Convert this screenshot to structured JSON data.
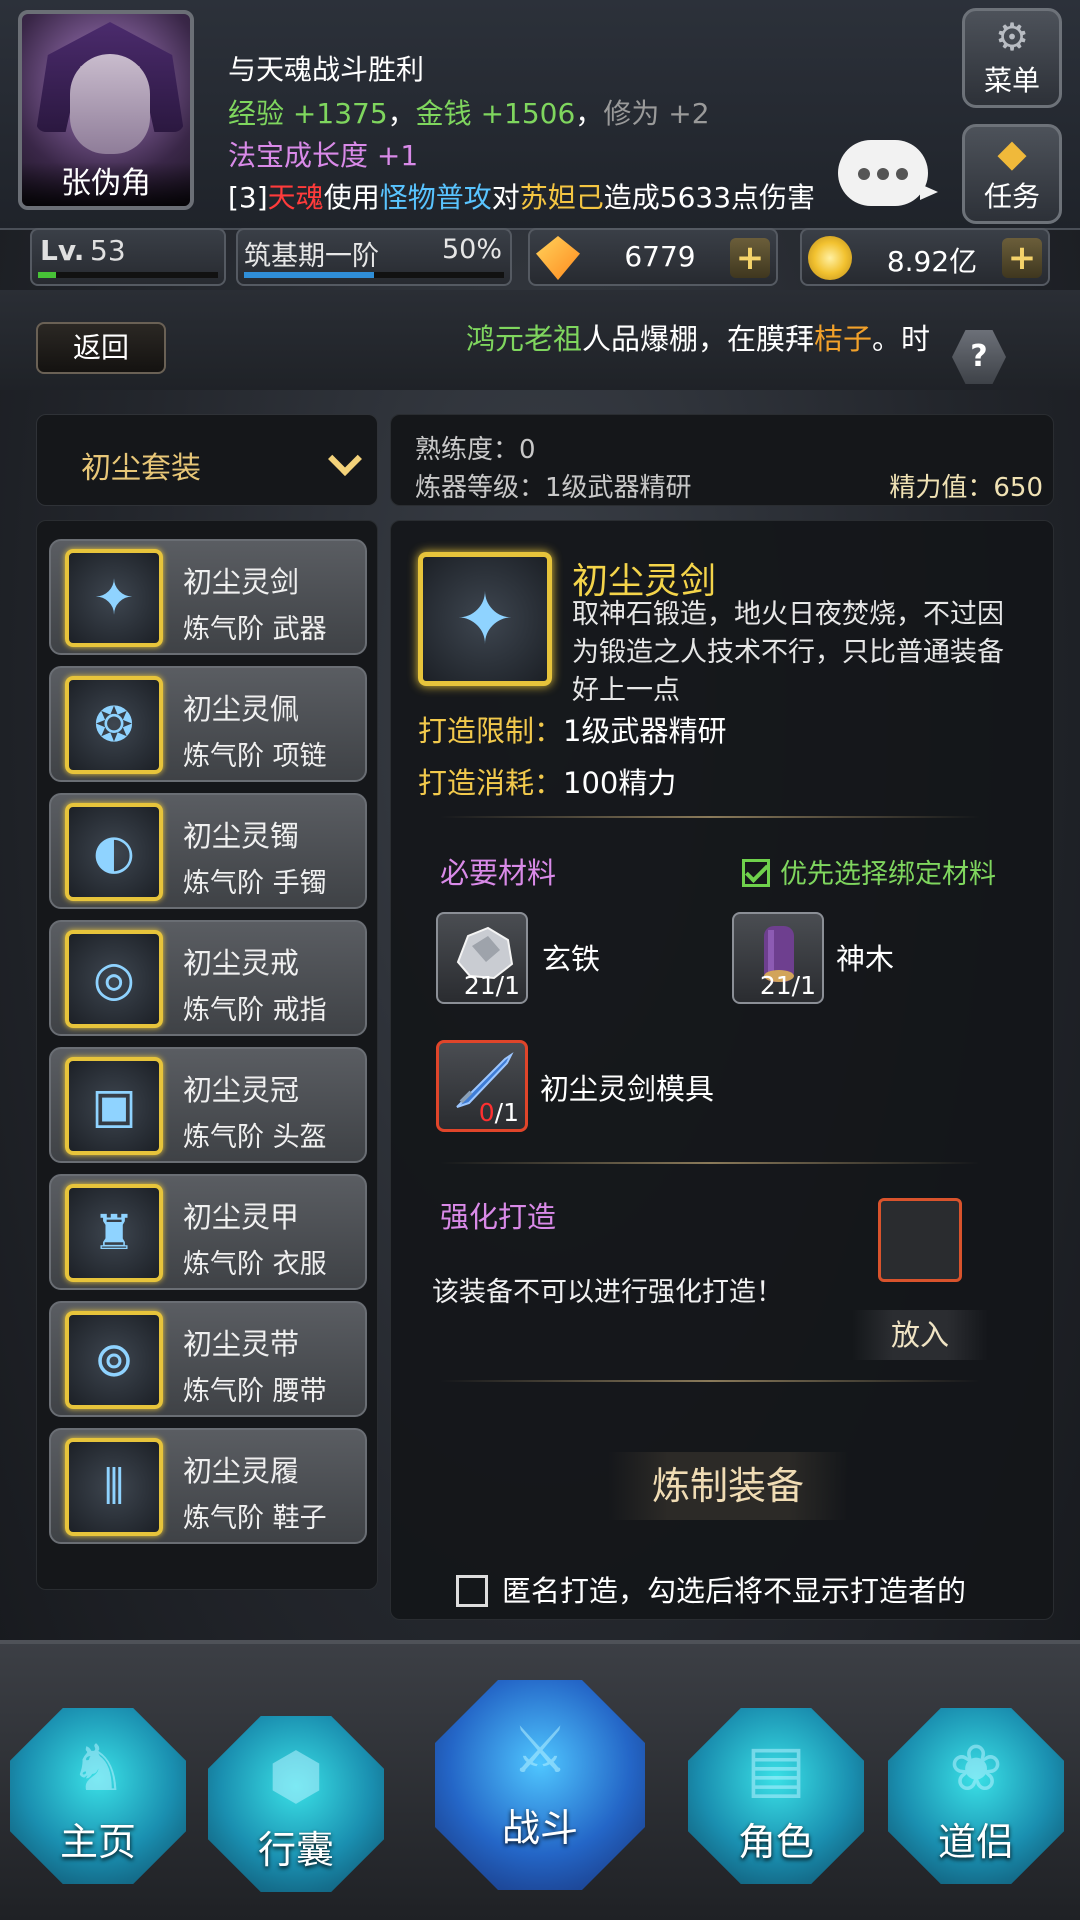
{
  "player": {
    "name": "张伪角",
    "level_label": "Lv.",
    "level": "53",
    "level_progress": 0.1,
    "realm": "筑基期一阶",
    "realm_percent": "50%",
    "realm_progress": 0.5,
    "gems": "6779",
    "gold": "8.92亿"
  },
  "battle_log": {
    "line1": "与天魂战斗胜利",
    "exp_label": "经验",
    "exp_value": "+1375",
    "sep1": "，",
    "money_label": "金钱",
    "money_value": "+1506",
    "sep2": "，",
    "cult_label": "修为",
    "cult_value": "+2",
    "growth_label": "法宝成长度",
    "growth_value": "+1",
    "l4_prefix": "[3]",
    "l4_actor": "天魂",
    "l4_mid1": "使用",
    "l4_skill": "怪物普攻",
    "l4_mid2": "对",
    "l4_target": "苏妲己",
    "l4_end": "造成5633点伤害"
  },
  "side_buttons": {
    "menu": "菜单",
    "task": "任务"
  },
  "back_label": "返回",
  "notice": {
    "name": "鸿元老祖",
    "text": "人品爆棚，在膜拜",
    "target": "桔子",
    "tail": "。时"
  },
  "help_label": "?",
  "set_select": "初尘套装",
  "info": {
    "proficiency": "熟练度：0",
    "forge_level": "炼器等级：1级武器精研",
    "energy": "精力值：650"
  },
  "items": [
    {
      "name": "初尘灵剑",
      "sub": "炼气阶 武器",
      "icon": "sword-icon"
    },
    {
      "name": "初尘灵佩",
      "sub": "炼气阶 项链",
      "icon": "pendant-icon"
    },
    {
      "name": "初尘灵镯",
      "sub": "炼气阶 手镯",
      "icon": "bracelet-icon"
    },
    {
      "name": "初尘灵戒",
      "sub": "炼气阶 戒指",
      "icon": "ring-icon"
    },
    {
      "name": "初尘灵冠",
      "sub": "炼气阶 头盔",
      "icon": "helmet-icon"
    },
    {
      "name": "初尘灵甲",
      "sub": "炼气阶 衣服",
      "icon": "armor-icon"
    },
    {
      "name": "初尘灵带",
      "sub": "炼气阶 腰带",
      "icon": "belt-icon"
    },
    {
      "name": "初尘灵履",
      "sub": "炼气阶 鞋子",
      "icon": "boots-icon"
    }
  ],
  "detail": {
    "name": "初尘灵剑",
    "desc": "取神石锻造，地火日夜焚烧，不过因为锻造之人技术不行，只比普通装备好上一点",
    "limit_label": "打造限制：",
    "limit_value": "1级武器精研",
    "cost_label": "打造消耗：",
    "cost_value": "100精力",
    "materials_title": "必要材料",
    "prefer_bound": "优先选择绑定材料",
    "materials": [
      {
        "name": "玄铁",
        "count": "21/1"
      },
      {
        "name": "神木",
        "count": "21/1"
      }
    ],
    "mold": {
      "name": "初尘灵剑模具",
      "have": "0",
      "need": "/1"
    },
    "enhance_title": "强化打造",
    "enhance_note": "该装备不可以进行强化打造！",
    "put_label": "放入",
    "forge_label": "炼制装备",
    "anonymous_label": "匿名打造，勾选后将不显示打造者的"
  },
  "nav": [
    "主页",
    "行囊",
    "战斗",
    "角色",
    "道侣"
  ],
  "colors": {
    "gold_text": "#f4d44a",
    "green": "#7fd65e",
    "pink": "#d98ae8",
    "red": "#ff3b3b",
    "blue": "#59c4ff"
  }
}
